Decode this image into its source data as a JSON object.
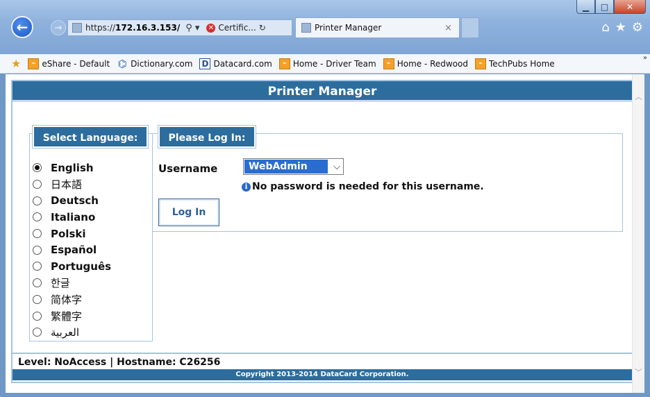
{
  "browser": {
    "address": {
      "prefix": "https://",
      "host": "172.16.3.153/",
      "cert_label": "Certific..."
    },
    "tab": {
      "title": "Printer Manager",
      "close": "×"
    },
    "favorites": [
      {
        "label": "eShare - Default",
        "icon": "orange-feed-icon"
      },
      {
        "label": "Dictionary.com",
        "icon": "dictionary-icon"
      },
      {
        "label": "Datacard.com",
        "icon": "datacard-icon"
      },
      {
        "label": "Home - Driver Team",
        "icon": "orange-feed-icon"
      },
      {
        "label": "Home - Redwood",
        "icon": "orange-feed-icon"
      },
      {
        "label": "TechPubs Home",
        "icon": "orange-feed-icon"
      }
    ]
  },
  "app": {
    "title": "Printer Manager",
    "language_section": {
      "title": "Select Language:",
      "languages": [
        {
          "label": "English",
          "selected": true
        },
        {
          "label": "日本語",
          "selected": false
        },
        {
          "label": "Deutsch",
          "selected": false
        },
        {
          "label": "Italiano",
          "selected": false
        },
        {
          "label": "Polski",
          "selected": false
        },
        {
          "label": "Español",
          "selected": false
        },
        {
          "label": "Português",
          "selected": false
        },
        {
          "label": "한글",
          "selected": false
        },
        {
          "label": "简体字",
          "selected": false
        },
        {
          "label": "繁體字",
          "selected": false
        },
        {
          "label": "العربية",
          "selected": false
        }
      ]
    },
    "login_section": {
      "title": "Please Log In:",
      "username_label": "Username",
      "username_value": "WebAdmin",
      "info_text": "No password is needed for this username.",
      "login_button": "Log In"
    },
    "footer": {
      "status": "Level: NoAccess | Hostname: C26256",
      "copyright": "Copyright 2013-2014 DataCard Corporation."
    }
  },
  "colors": {
    "header_blue": "#2c6d9e",
    "border_blue": "#a5c3e2",
    "select_blue": "#2a6dd1"
  }
}
